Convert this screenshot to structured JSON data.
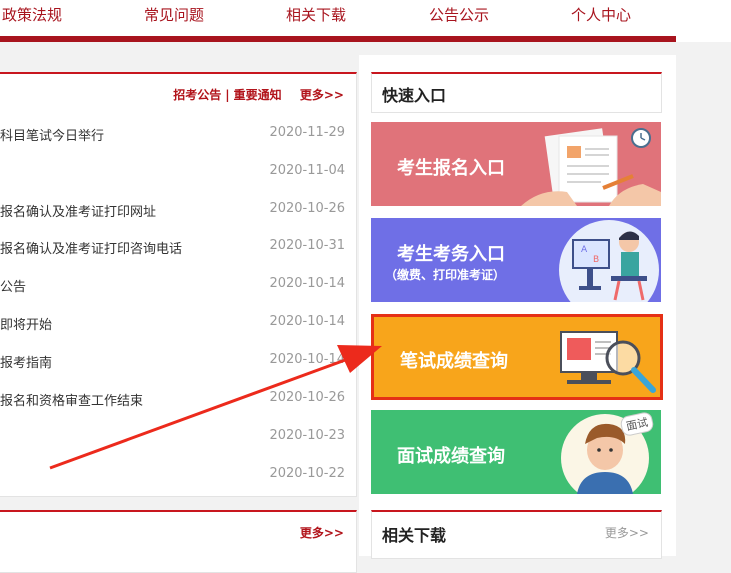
{
  "nav": {
    "items": [
      "政策法规",
      "常见问题",
      "相关下载",
      "公告公示",
      "个人中心"
    ]
  },
  "news": {
    "tabs": [
      "招考公告",
      "重要通知"
    ],
    "more": "更多>>",
    "rows": [
      {
        "title": "科目笔试今日举行",
        "date": "2020-11-29"
      },
      {
        "title": "",
        "date": "2020-11-04"
      },
      {
        "title": "报名确认及准考证打印网址",
        "date": "2020-10-26"
      },
      {
        "title": "报名确认及准考证打印咨询电话",
        "date": "2020-10-31"
      },
      {
        "title": "公告",
        "date": "2020-10-14"
      },
      {
        "title": "即将开始",
        "date": "2020-10-14"
      },
      {
        "title": "报考指南",
        "date": "2020-10-14"
      },
      {
        "title": "报名和资格审查工作结束",
        "date": "2020-10-26"
      },
      {
        "title": "",
        "date": "2020-10-23"
      },
      {
        "title": "",
        "date": "2020-10-22"
      }
    ]
  },
  "bottom": {
    "more": "更多>>"
  },
  "quick": {
    "title": "快速入口",
    "cards": [
      {
        "label": "考生报名入口"
      },
      {
        "label": "考生考务入口",
        "sub": "（缴费、打印准考证）"
      },
      {
        "label": "笔试成绩查询"
      },
      {
        "label": "面试成绩查询",
        "tag": "面试"
      }
    ]
  },
  "downloads": {
    "title": "相关下载",
    "more": "更多>>"
  },
  "colors": {
    "brand": "#a8141e",
    "card1": "#e0737a",
    "card2": "#6f6fe6",
    "card3": "#f8a51b",
    "card4": "#3fbf73",
    "highlight": "#e53016"
  }
}
